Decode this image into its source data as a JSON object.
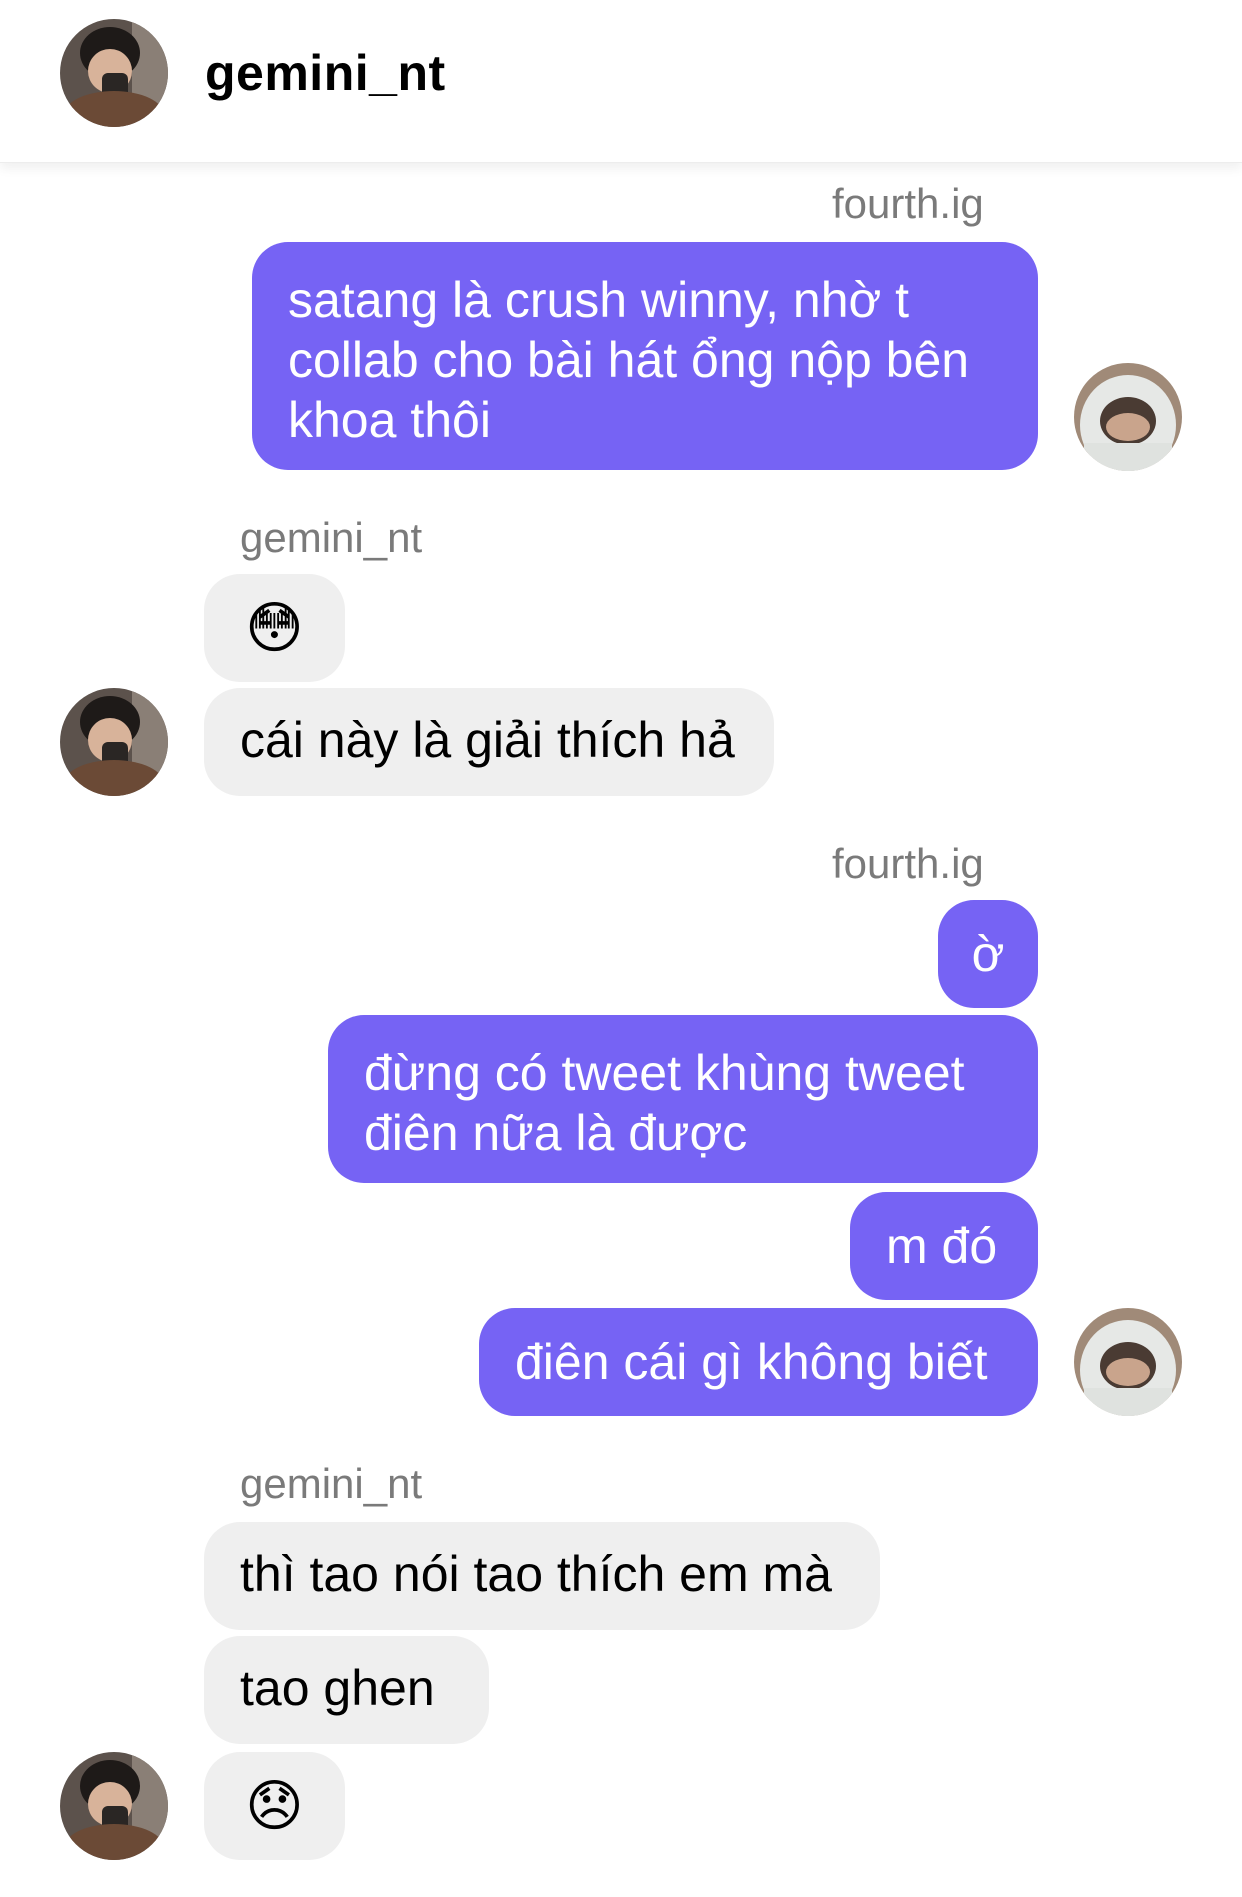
{
  "header": {
    "username": "gemini_nt",
    "avatar_icon": "profile-photo-avatar"
  },
  "thread": {
    "sender_labels": {
      "s1": "fourth.ig",
      "s2": "gemini_nt",
      "s3": "fourth.ig",
      "s4": "gemini_nt"
    },
    "messages": {
      "m1": "satang là crush winny, nhờ t\ncollab cho bài hát ổng nộp bên\nkhoa thôi",
      "m2": "😳",
      "m3": "cái này là giải thích hả",
      "m4": "ờ",
      "m5": "đừng có tweet khùng tweet\nđiên nữa là được",
      "m6": "m đó",
      "m7": "điên cái gì không biết",
      "m8": "thì tao nói tao thích em mà",
      "m9": "tao ghen",
      "m10": "😞"
    }
  },
  "colors": {
    "outgoing_bubble": "#7663f4",
    "incoming_bubble": "#efefef",
    "sender_label": "#7a7a7a"
  }
}
